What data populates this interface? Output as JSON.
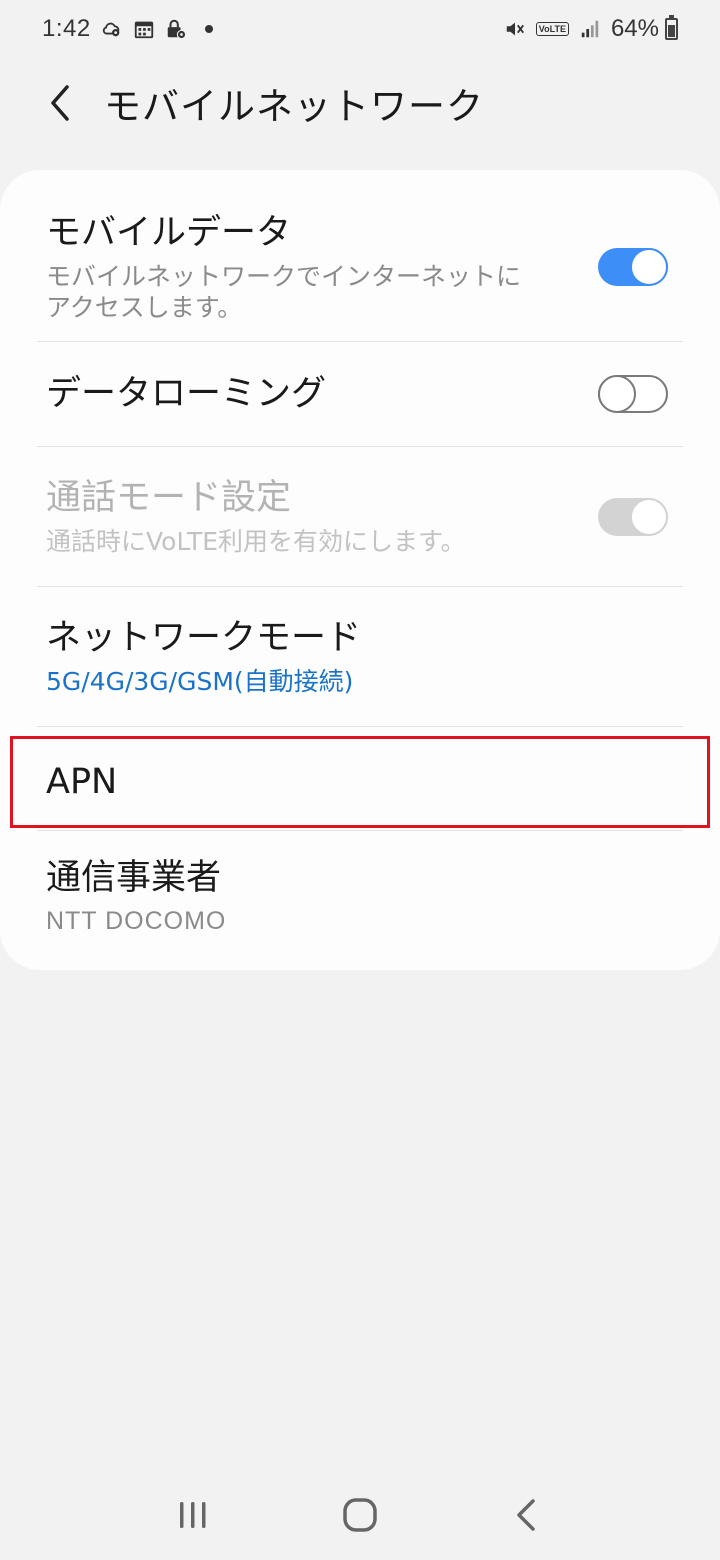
{
  "status_bar": {
    "time": "1:42",
    "left_icons": [
      "cloud-gear-icon",
      "calendar-icon",
      "lock-gear-icon"
    ],
    "volte_label": "VoLTE",
    "battery": "64%",
    "battery_level": 0.64
  },
  "header": {
    "title": "モバイルネットワーク"
  },
  "settings": {
    "mobile_data": {
      "title": "モバイルデータ",
      "subtitle_line1": "モバイルネットワークでインターネットに",
      "subtitle_line2": "アクセスします。",
      "enabled": true
    },
    "data_roaming": {
      "title": "データローミング",
      "enabled": false
    },
    "call_mode": {
      "title": "通話モード設定",
      "subtitle": "通話時にVoLTE利用を有効にします。",
      "enabled": true,
      "disabled": true
    },
    "network_mode": {
      "title": "ネットワークモード",
      "value": "5G/4G/3G/GSM(自動接続)"
    },
    "apn": {
      "title": "APN"
    },
    "carrier": {
      "title": "通信事業者",
      "value": "NTT DOCOMO"
    }
  },
  "colors": {
    "accent": "#3e8ef7",
    "highlight": "#e0121f",
    "link_blue": "#1a73c8"
  }
}
